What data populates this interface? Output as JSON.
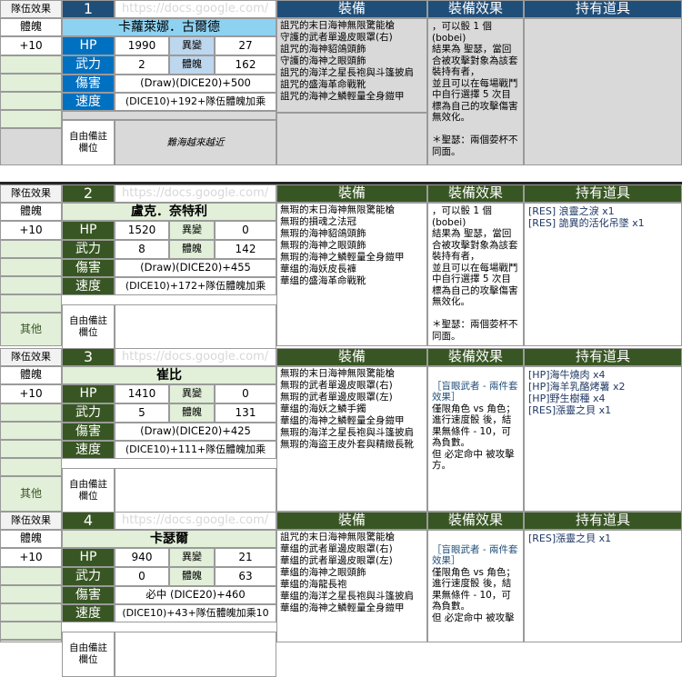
{
  "blocks": [
    {
      "num": "1",
      "name": "卡蘿萊娜．古爾德",
      "hp": "1990",
      "variant": "27",
      "atk": "2",
      "con": "162",
      "dmg": "(Draw)(DICE20)+500",
      "spd": "(DICE10)+192+隊伍體魄加乘",
      "equip": [
        "詛咒的末日海神無限驚能槍",
        "守護的武者單邊皮眼罩(右)",
        "詛咒的海神貂鴿頭飾",
        "守護的海神之眼頭飾",
        "詛咒的海洋之星長袍與斗篷披肩",
        "詛咒的盛海革命戰靴",
        "詛咒的海神之鱗輕量全身鎧甲"
      ],
      "effect": [
        "，可以骰 1 個",
        "(bobei)",
        "結果為 聖瑟，當回",
        "合被攻擊對象為該套",
        "裝持有者，",
        "並且可以在每場戰鬥",
        "中自行選擇 5 次目",
        "標為自己的攻擊傷害",
        "無效化。",
        "",
        "＊聖瑟：兩個荌杯不",
        "同面。"
      ],
      "items": [],
      "notes": "難海越來越近",
      "show_other": false
    },
    {
      "num": "2",
      "name": "盧克．奈特利",
      "hp": "1520",
      "variant": "0",
      "atk": "8",
      "con": "142",
      "dmg": "(Draw)(DICE20)+455",
      "spd": "(DICE10)+172+隊伍體魄加乘",
      "equip": [
        "無瑕的末日海神無限驚能槍",
        "無瑕的損魂之法冠",
        "無瑕的海神貂鴿頭飾",
        "無瑕的海神之眼頭飾",
        "無瑕的海神之鱗輕量全身鎧甲",
        "華缊的海妖皮長褲",
        "華缊的盛海革命戰靴"
      ],
      "effect": [
        "，可以骰 1 個",
        "(bobei)",
        "結果為 聖瑟，當回",
        "合被攻擊對象為該套",
        "裝持有者，",
        "並且可以在每場戰鬥",
        "中自行選擇 5 次目",
        "標為自己的攻擊傷害",
        "無效化。",
        "",
        "＊聖瑟：兩個荌杯不",
        "同面。"
      ],
      "items": [
        "[RES] 浪靈之淚 x1",
        "[RES] 詭異的活化吊墜 x1"
      ],
      "notes": "",
      "show_other": true
    },
    {
      "num": "3",
      "name": "崔比",
      "hp": "1410",
      "variant": "0",
      "atk": "5",
      "con": "131",
      "dmg": "(Draw)(DICE20)+425",
      "spd": "(DICE10)+111+隊伍體魄加乘",
      "equip": [
        "無瑕的末日海神無限驚能槍",
        "無瑕的武者單邊皮眼罩(右)",
        "無瑕的武者單邊皮眼罩(左)",
        "華缊的海妖之鱗手鐲",
        "華缊的海神之鱗輕量全身鎧甲",
        "無瑕的海洋之星長袍與斗篷披肩",
        "無瑕的海盜王皮外套與精緻長靴"
      ],
      "effect": [
        "",
        "［盲眼武者 - 兩件套",
        "效果］",
        "僅限角色 vs 角色；",
        "進行速度骰 後，結",
        "果無條件 - 10，可",
        "為負數。",
        "但 必定命中 被攻擊",
        "方。"
      ],
      "items": [
        "[HP]海牛燒肉 x4",
        "[HP]海羊乳酪烤薯 x2",
        "[HP]野生樹種 x4",
        "[RES]漲靈之貝 x1"
      ],
      "notes": "",
      "show_other": true
    },
    {
      "num": "4",
      "name": "卡瑟爾",
      "hp": "940",
      "variant": "21",
      "atk": "0",
      "con": "63",
      "dmg": "必中 (DICE20)+460",
      "spd": "(DICE10)+43+隊伍體魄加乘10",
      "equip": [
        "詛咒的末日海神無限驚能槍",
        "華缊的武者單邊皮眼罩(右)",
        "華缊的武者單邊皮眼罩(左)",
        "華缊的海神之眼頭飾",
        "華缊的海龍長袍",
        "華缊的海洋之星長袍與斗篷披肩",
        "華缊的海神之鱗輕量全身鎧甲"
      ],
      "effect": [
        "",
        "［盲眼武者 - 兩件套",
        "效果］",
        "僅限角色 vs 角色；",
        "進行速度骰 後，結",
        "果無條件 - 10，可",
        "為負數。",
        "但 必定命中 被攻擊"
      ],
      "items": [
        "[RES]漲靈之貝 x1"
      ],
      "notes": "",
      "show_other": false
    }
  ],
  "labels": {
    "team_effect": "隊伍效果",
    "physique": "體魄",
    "physique_bonus": "+10",
    "hp": "HP",
    "variant": "異變",
    "atk": "武力",
    "con": "體魄",
    "dmg": "傷害",
    "spd": "速度",
    "equip": "裝備",
    "effect": "裝備效果",
    "items": "持有道具",
    "free_note": "自由備註\n欄位",
    "other": "其他",
    "url": "https://docs.google.com/"
  },
  "colors": {
    "block1_header": "#1f4e79",
    "block_header": "#385623",
    "light_green": "#e2efd9",
    "light_gray": "#f2f2f2"
  }
}
